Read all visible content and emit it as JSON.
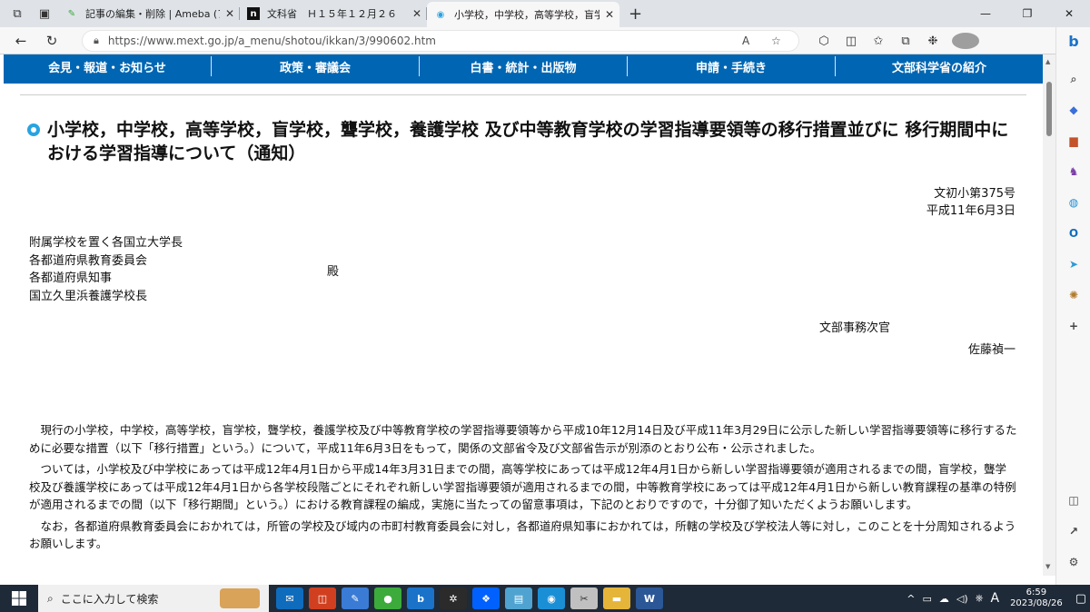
{
  "tabs": [
    {
      "title": "記事の編集・削除 | Ameba (アメー/",
      "fav_color": "#3cab3c",
      "fav_glyph": "✎"
    },
    {
      "title": "文科省　Ｈ１５年１２月２６",
      "fav_color": "#111111",
      "fav_glyph": "n"
    },
    {
      "title": "小学校，中学校，高等学校，盲学",
      "fav_color": "#2aa3e0",
      "fav_glyph": "◉"
    }
  ],
  "window_controls": {
    "minimize": "—",
    "maximize": "❐",
    "close": "✕"
  },
  "address": {
    "url": "https://www.mext.go.jp/a_menu/shotou/ikkan/3/990602.htm"
  },
  "site_nav": [
    "会見・報道・お知らせ",
    "政策・審議会",
    "白書・統計・出版物",
    "申請・手続き",
    "文部科学省の紹介"
  ],
  "doc": {
    "title": "小学校，中学校，高等学校，盲学校，聾学校，養護学校 及び中等教育学校の学習指導要領等の移行措置並びに 移行期間中における学習指導について（通知）",
    "doc_number": "文初小第375号",
    "doc_date": "平成11年6月3日",
    "recipients": [
      "附属学校を置く各国立大学長",
      "各都道府県教育委員会",
      "各都道府県知事",
      "国立久里浜養護学校長"
    ],
    "dono": "殿",
    "sender_title": "文部事務次官",
    "sender_name": "佐藤禎一",
    "paragraphs": [
      "現行の小学校，中学校，高等学校，盲学校，聾学校，養護学校及び中等教育学校の学習指導要領等から平成10年12月14日及び平成11年3月29日に公示した新しい学習指導要領等に移行するために必要な措置（以下「移行措置」という。）について，平成11年6月3日をもって，関係の文部省令及び文部省告示が別添のとおり公布・公示されました。",
      "ついては，小学校及び中学校にあっては平成12年4月1日から平成14年3月31日までの間，高等学校にあっては平成12年4月1日から新しい学習指導要領が適用されるまでの間，盲学校，聾学校及び養護学校にあっては平成12年4月1日から各学校段階ごとにそれぞれ新しい学習指導要領が適用されるまでの間，中等教育学校にあっては平成12年4月1日から新しい教育課程の基準の特例が適用されるまでの間（以下「移行期間」という。）における教育課程の編成，実施に当たっての留意事項は，下記のとおりですので，十分御了知いただくようお願いします。",
      "なお，各都道府県教育委員会におかれては，所管の学校及び域内の市町村教育委員会に対し，各都道府県知事におかれては，所轄の学校及び学校法人等に対し，このことを十分周知されるようお願いします。"
    ]
  },
  "taskbar": {
    "search_placeholder": "ここに入力して検索",
    "apps": [
      {
        "name": "mail",
        "color": "#0f6cbd",
        "glyph": "✉"
      },
      {
        "name": "app-red",
        "color": "#d04020",
        "glyph": "◫"
      },
      {
        "name": "paint",
        "color": "#3a7bd5",
        "glyph": "✎"
      },
      {
        "name": "ameba",
        "color": "#3cab3c",
        "glyph": "●"
      },
      {
        "name": "bing",
        "color": "#1a73c8",
        "glyph": "b"
      },
      {
        "name": "slack",
        "color": "#2b2b2b",
        "glyph": "✲"
      },
      {
        "name": "dropbox",
        "color": "#0061fe",
        "glyph": "❖"
      },
      {
        "name": "notepad",
        "color": "#4fa3d1",
        "glyph": "▤"
      },
      {
        "name": "edge",
        "color": "#1b8fd6",
        "glyph": "◉"
      },
      {
        "name": "tool",
        "color": "#c0c0c0",
        "glyph": "✂"
      },
      {
        "name": "explorer",
        "color": "#e5b53a",
        "glyph": "▬"
      },
      {
        "name": "word",
        "color": "#2b5797",
        "glyph": "W"
      }
    ],
    "ime": "A",
    "time": "6:59",
    "date": "2023/08/26"
  }
}
